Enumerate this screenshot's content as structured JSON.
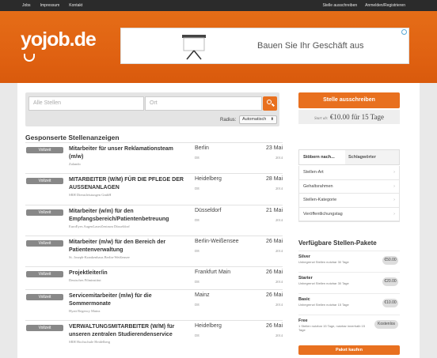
{
  "topbar": {
    "left": [
      "Jobs",
      "Impressum",
      "Kontakt"
    ],
    "right": [
      "Stelle ausschreiben",
      "Anmelden/Registrieren"
    ]
  },
  "brand": {
    "logo": "yojob.de",
    "accent": "#e8701f"
  },
  "ad": {
    "text": "Bauen Sie Ihr Geschäft aus"
  },
  "search": {
    "what_placeholder": "Alle Stellen",
    "where_placeholder": "Ort",
    "radius_label": "Radius:",
    "radius_value": "Automatisch"
  },
  "sponsored_title": "Gesponserte Stellenanzeigen",
  "jobs": [
    {
      "badge": "Vollzeit",
      "title": "Mitarbeiter für unser Reklamationsteam (m/w)",
      "company": "Zalando",
      "city": "Berlin",
      "country": "DE",
      "date": "23 Mai",
      "year": "2014"
    },
    {
      "badge": "Vollzeit",
      "title": "MITARBEITER (W/M) FÜR DIE PFLEGE DER AUSSENANLAGEN",
      "company": "SRH Dienstleistungen GmbH",
      "city": "Heidelberg",
      "country": "DE",
      "date": "28 Mai",
      "year": "2014"
    },
    {
      "badge": "Vollzeit",
      "title": "Mitarbeiter (w/m) für den Empfangsbereich/Patientenbetreuung",
      "company": "EuroEyes AugenLaserZentrum Düsseldorf",
      "city": "Düsseldorf",
      "country": "DE",
      "date": "21 Mai",
      "year": "2014"
    },
    {
      "badge": "Vollzeit",
      "title": "Mitarbeiter (m/w) für den Bereich der Patientenverwaltung",
      "company": "St. Joseph-Krankenhaus Berlin-Weißensee",
      "city": "Berlin-Weißensee",
      "country": "DE",
      "date": "26 Mai",
      "year": "2014"
    },
    {
      "badge": "Vollzeit",
      "title": "Projektleiter/in",
      "company": "Deutsches Filminstitut",
      "city": "Frankfurt Main",
      "country": "DE",
      "date": "26 Mai",
      "year": "2014"
    },
    {
      "badge": "Vollzeit",
      "title": "Servicemitarbeiter (m/w) für die Sommermonate",
      "company": "Hyatt Regency Mainz",
      "city": "Mainz",
      "country": "DE",
      "date": "26 Mai",
      "year": "2014"
    },
    {
      "badge": "Vollzeit",
      "title": "VERWALTUNGSMITARBEITER (W/M) für unseren zentralen Studierendenservice",
      "company": "SRH Hochschule Heidelberg",
      "city": "Heidelberg",
      "country": "DE",
      "date": "26 Mai",
      "year": "2014"
    }
  ],
  "sidebar": {
    "post_button": "Stelle ausschreiben",
    "price_prefix": "Start ab:",
    "price": "€10.00",
    "price_for": "für",
    "price_days": "15 Tage",
    "tabs": [
      "Stöbern nach...",
      "Schlagwörter"
    ],
    "filters": [
      "Stellen-Art",
      "Gehaltsrahmen",
      "Stellen-Kategorie",
      "Veröffentlichungstag"
    ],
    "packages_title": "Verfügbare Stellen-Pakete",
    "packages": [
      {
        "name": "Silver",
        "desc": "Unbegrenzt Stellen nutzbar 30 Tage",
        "price": "€50.00"
      },
      {
        "name": "Starter",
        "desc": "Unbegrenzt Stellen nutzbar 30 Tage",
        "price": "€20.00"
      },
      {
        "name": "Basic",
        "desc": "Unbegrenzt Stellen nutzbar 15 Tage",
        "price": "€10.00"
      },
      {
        "name": "Free",
        "desc": "1 Stellen nutzbar 15 Tage, nutzbar innerhalb 15 Tage",
        "price": "Kostenlos"
      }
    ],
    "buy_button": "Paket kaufen"
  }
}
